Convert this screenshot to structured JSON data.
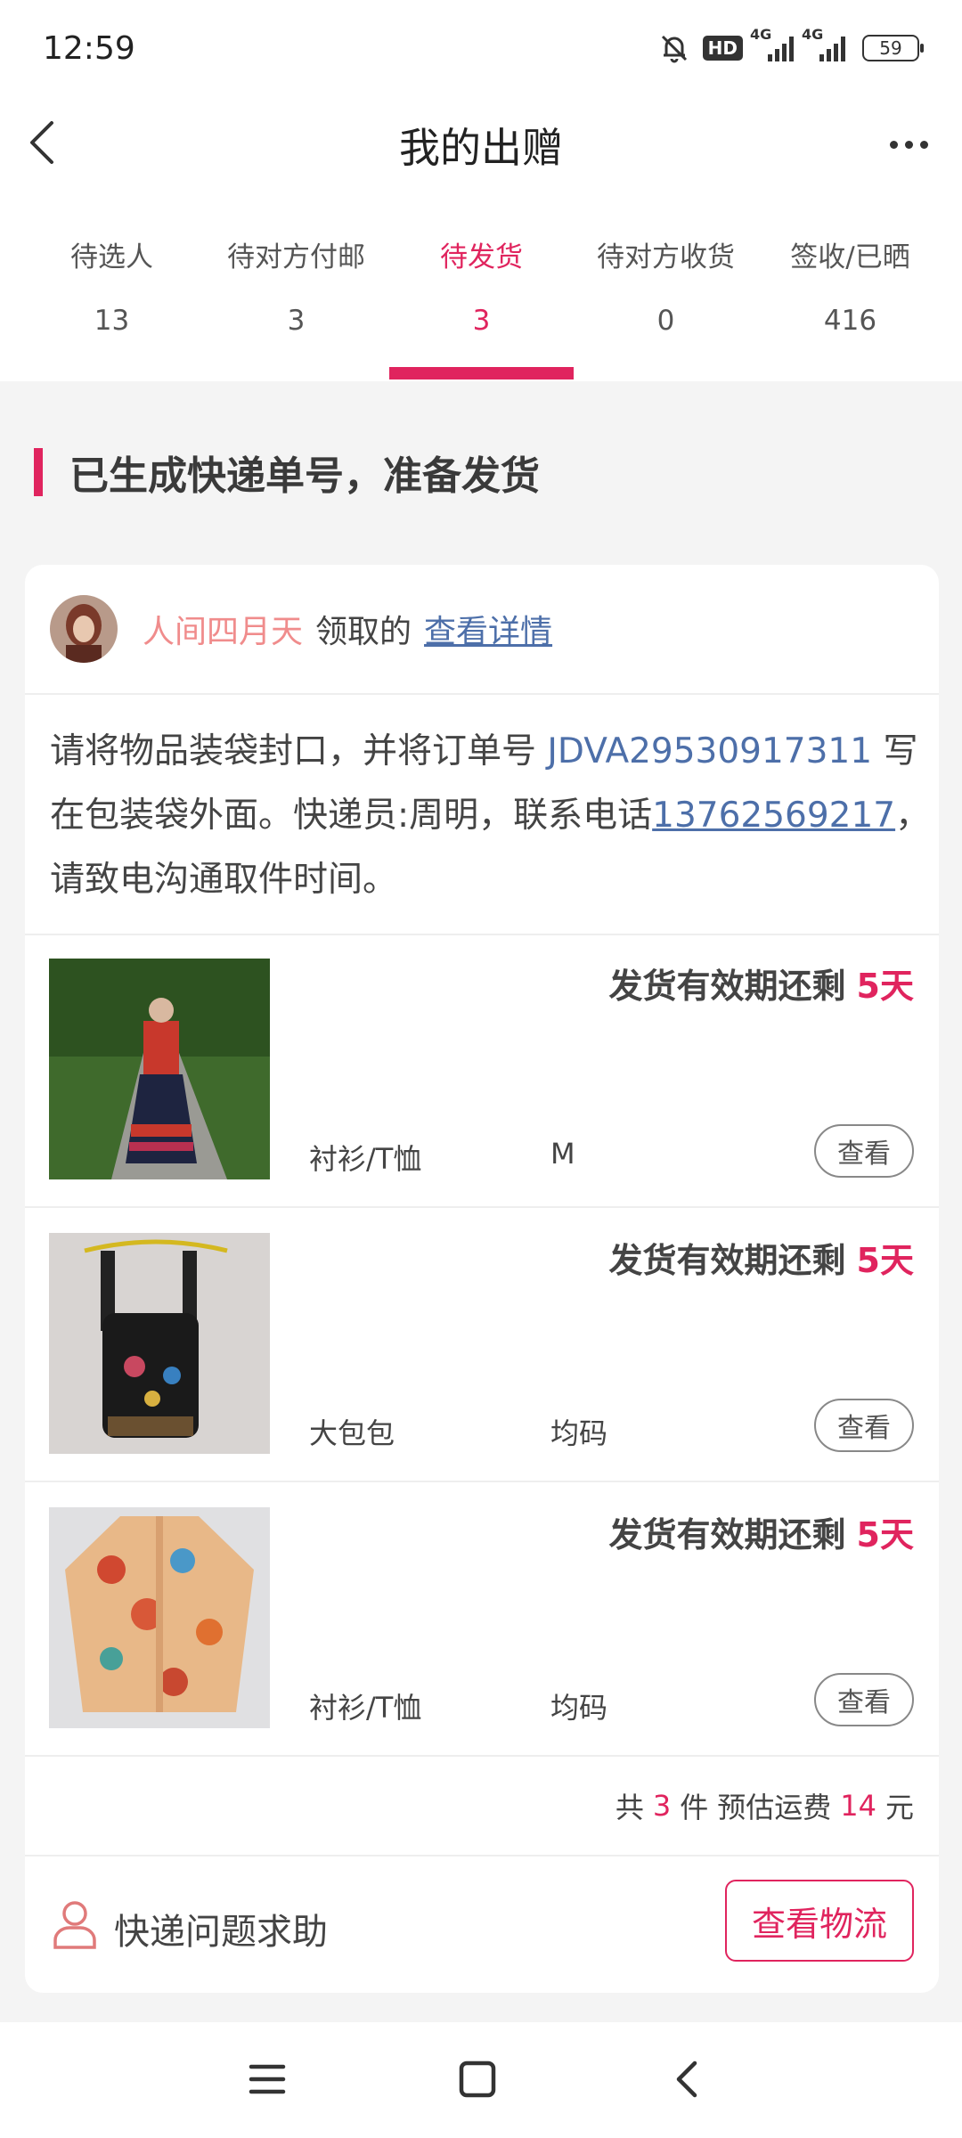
{
  "status_bar": {
    "time": "12:59",
    "hd_badge": "HD",
    "network_1": "4G",
    "network_2": "4G",
    "battery": "59"
  },
  "nav": {
    "title": "我的出赠",
    "back_icon": "chevron-left-icon",
    "more_icon": "more-horizontal-icon"
  },
  "tabs": [
    {
      "label": "待选人",
      "count": "13"
    },
    {
      "label": "待对方付邮",
      "count": "3"
    },
    {
      "label": "待发货",
      "count": "3"
    },
    {
      "label": "待对方收货",
      "count": "0"
    },
    {
      "label": "签收/已晒",
      "count": "416"
    }
  ],
  "active_tab_index": 2,
  "section": {
    "title": "已生成快递单号，准备发货"
  },
  "donor": {
    "name": "人间四月天",
    "suffix": "领取的",
    "detail_link": "查看详情"
  },
  "instruction": {
    "part1": "请将物品装袋封口，并将订单号 ",
    "order_no": "JDVA29530917311",
    "part2": " 写在包装袋外面。快递员:周明，联系电话",
    "phone": "13762569217",
    "part3": "，请致电沟通取件时间。"
  },
  "items": [
    {
      "deadline_label": "发货有效期还剩",
      "days": "5天",
      "category": "衬衫/T恤",
      "size": "M",
      "view_label": "查看"
    },
    {
      "deadline_label": "发货有效期还剩",
      "days": "5天",
      "category": "大包包",
      "size": "均码",
      "view_label": "查看"
    },
    {
      "deadline_label": "发货有效期还剩",
      "days": "5天",
      "category": "衬衫/T恤",
      "size": "均码",
      "view_label": "查看"
    }
  ],
  "summary": {
    "prefix": "共",
    "count": "3",
    "unit": "件",
    "fee_label": "预估运费",
    "fee": "14",
    "currency": "元"
  },
  "help": {
    "label": "快递问题求助",
    "icon": "user-icon",
    "logistics_button": "查看物流"
  },
  "colors": {
    "accent": "#e0245e",
    "link": "#4d6fa9",
    "donor_name": "#f08c8c"
  }
}
